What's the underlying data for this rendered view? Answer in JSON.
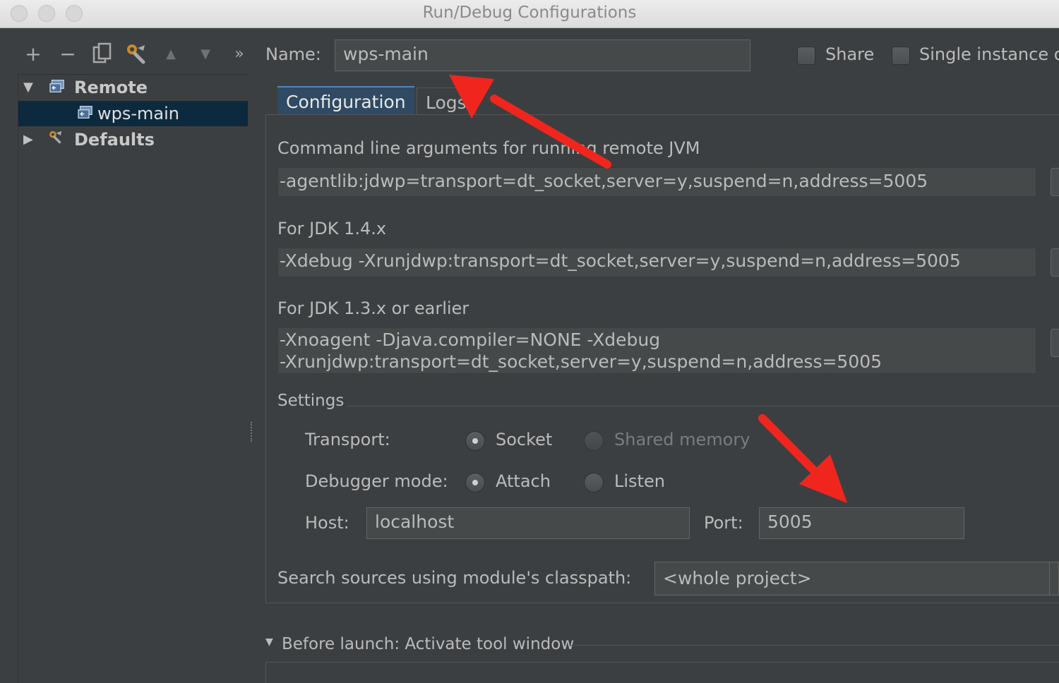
{
  "window": {
    "title": "Run/Debug Configurations"
  },
  "toolbar": {
    "add_icon": "plus-icon",
    "remove_icon": "minus-icon",
    "copy_icon": "copy-icon",
    "settings_icon": "wrench-icon",
    "move_up_icon": "arrow-up-icon",
    "move_down_icon": "arrow-down-icon",
    "more_label": "»"
  },
  "tree": {
    "items": [
      {
        "label": "Remote",
        "expanded": true
      },
      {
        "label": "wps-main",
        "selected": true
      },
      {
        "label": "Defaults",
        "expanded": false
      }
    ]
  },
  "header": {
    "name_label": "Name:",
    "name_value": "wps-main",
    "share_label": "Share",
    "share_checked": false,
    "single_instance_label": "Single instance o",
    "single_instance_checked": false
  },
  "tabs": [
    {
      "label": "Configuration",
      "active": true
    },
    {
      "label": "Logs",
      "active": false
    }
  ],
  "config": {
    "cmd_args_label": "Command line arguments for running remote JVM",
    "cmd_args_value": "-agentlib:jdwp=transport=dt_socket,server=y,suspend=n,address=5005",
    "jdk14_label": "For JDK 1.4.x",
    "jdk14_value": "-Xdebug -Xrunjdwp:transport=dt_socket,server=y,suspend=n,address=5005",
    "jdk13_label": "For JDK 1.3.x or earlier",
    "jdk13_line1": "-Xnoagent -Djava.compiler=NONE -Xdebug",
    "jdk13_line2": "-Xrunjdwp:transport=dt_socket,server=y,suspend=n,address=5005"
  },
  "settings": {
    "section_label": "Settings",
    "transport_label": "Transport:",
    "transport_socket": "Socket",
    "transport_shared": "Shared memory",
    "transport_selected": "Socket",
    "debugger_label": "Debugger mode:",
    "debugger_attach": "Attach",
    "debugger_listen": "Listen",
    "debugger_selected": "Attach",
    "host_label": "Host:",
    "host_value": "localhost",
    "port_label": "Port:",
    "port_value": "5005"
  },
  "classpath": {
    "label": "Search sources using module's classpath:",
    "value": "<whole project>"
  },
  "before_launch": {
    "label": "Before launch: Activate tool window"
  },
  "colors": {
    "background": "#3c3f41",
    "field": "#45494a",
    "selection": "#0d293e",
    "active_tab": "#2f4a62",
    "annotation_arrow": "#f0261e"
  }
}
